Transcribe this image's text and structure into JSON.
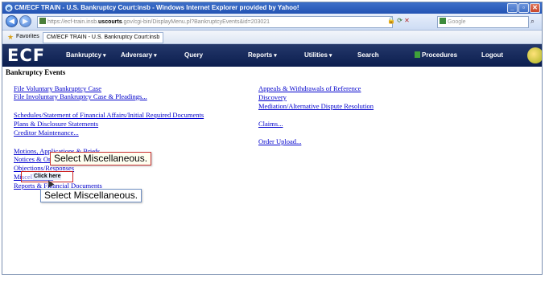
{
  "browser": {
    "title": "CM/ECF TRAIN - U.S. Bankruptcy Court:insb - Windows Internet Explorer provided by Yahoo!",
    "url_prefix": "https://ecf-train.insb.",
    "url_domain": "uscourts",
    "url_suffix": ".gov/cgi-bin/DisplayMenu.pl?BankruptcyEvents&id=203021",
    "search_placeholder": "Google",
    "favorites_label": "Favorites",
    "tab_title": "CM/ECF TRAIN - U.S. Bankruptcy Court:insb"
  },
  "ecf": {
    "logo": "ECF",
    "menu": [
      {
        "label": "Bankruptcy",
        "chevron": true
      },
      {
        "label": "Adversary",
        "chevron": true
      },
      {
        "label": "Query",
        "chevron": false
      },
      {
        "label": "Reports",
        "chevron": true
      },
      {
        "label": "Utilities",
        "chevron": true
      },
      {
        "label": "Search",
        "chevron": false
      },
      {
        "label": "Procedures",
        "chevron": false
      },
      {
        "label": "Logout",
        "chevron": false
      }
    ]
  },
  "page": {
    "heading": "Bankruptcy Events",
    "left_links": [
      "File Voluntary Bankruptcy Case",
      "File Involuntary Bankruptcy Case & Pleadings...",
      "Schedules/Statement of Financial Affairs/Initial Required Documents",
      "Plans & Disclosure Statements",
      "Creditor Maintenance...",
      "Motions, Applications & Briefs",
      "Notices & Orders",
      "Objections/Responses",
      "Miscellaneous",
      "Reports & Financial Documents"
    ],
    "right_links": [
      "Appeals & Withdrawals of Reference",
      "Discovery",
      "Mediation/Alternative Dispute Resolution",
      "Claims...",
      "Order Upload..."
    ]
  },
  "tutorial": {
    "callout_top": "Select Miscellaneous.",
    "callout_bottom": "Select Miscellaneous.",
    "click_label": "Click here"
  }
}
